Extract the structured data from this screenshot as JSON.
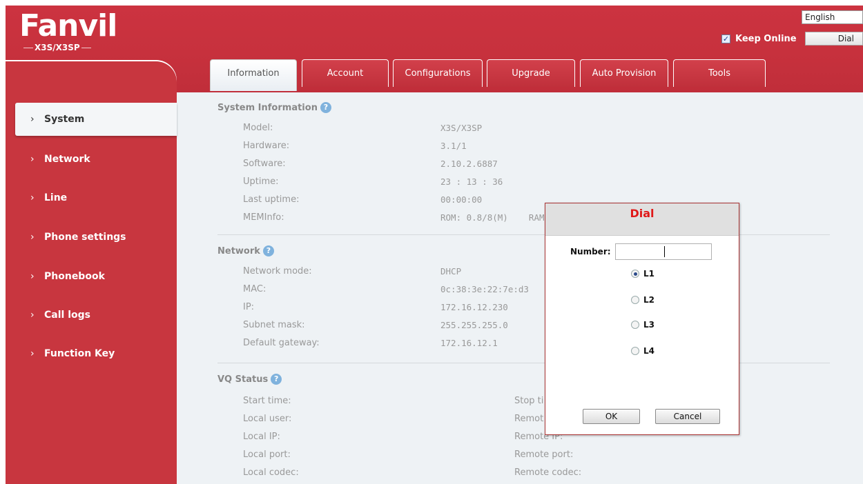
{
  "header": {
    "brand": "Fanvil",
    "model": "X3S/X3SP",
    "language": "English",
    "keep_online_label": "Keep Online",
    "keep_online_checked": true,
    "dial_button": "Dial"
  },
  "tabs": [
    {
      "label": "Information",
      "active": true
    },
    {
      "label": "Account"
    },
    {
      "label": "Configurations"
    },
    {
      "label": "Upgrade"
    },
    {
      "label": "Auto Provision"
    },
    {
      "label": "Tools"
    }
  ],
  "sidebar": {
    "items": [
      {
        "label": "System",
        "active": true
      },
      {
        "label": "Network"
      },
      {
        "label": "Line"
      },
      {
        "label": "Phone settings"
      },
      {
        "label": "Phonebook"
      },
      {
        "label": "Call logs"
      },
      {
        "label": "Function Key"
      }
    ]
  },
  "system_info": {
    "title": "System Information",
    "rows": [
      {
        "label": "Model:",
        "value": "X3S/X3SP"
      },
      {
        "label": "Hardware:",
        "value": "3.1/1"
      },
      {
        "label": "Software:",
        "value": "2.10.2.6887"
      },
      {
        "label": "Uptime:",
        "value": "23 : 13 : 36"
      },
      {
        "label": "Last uptime:",
        "value": "00:00:00"
      },
      {
        "label": "MEMInfo:",
        "value": "ROM: 0.8/8(M)    RAM"
      }
    ]
  },
  "network": {
    "title": "Network",
    "rows": [
      {
        "label": "Network mode:",
        "value": "DHCP"
      },
      {
        "label": "MAC:",
        "value": "0c:38:3e:22:7e:d3"
      },
      {
        "label": "IP:",
        "value": "172.16.12.230"
      },
      {
        "label": "Subnet mask:",
        "value": "255.255.255.0"
      },
      {
        "label": "Default gateway:",
        "value": "172.16.12.1"
      }
    ]
  },
  "vq_status": {
    "title": "VQ Status",
    "left": [
      "Start time:",
      "Local user:",
      "Local IP:",
      "Local port:",
      "Local codec:"
    ],
    "right": [
      "Stop ti",
      "Remot",
      "Remote IP:",
      "Remote port:",
      "Remote codec:"
    ]
  },
  "dial_dialog": {
    "title": "Dial",
    "number_label": "Number:",
    "number_value": "",
    "lines": [
      {
        "label": "L1",
        "checked": true
      },
      {
        "label": "L2"
      },
      {
        "label": "L3"
      },
      {
        "label": "L4"
      }
    ],
    "ok": "OK",
    "cancel": "Cancel"
  },
  "colors": {
    "brand_red": "#c8363f",
    "content_bg": "#eef2f5",
    "dialog_title": "#e01818"
  }
}
